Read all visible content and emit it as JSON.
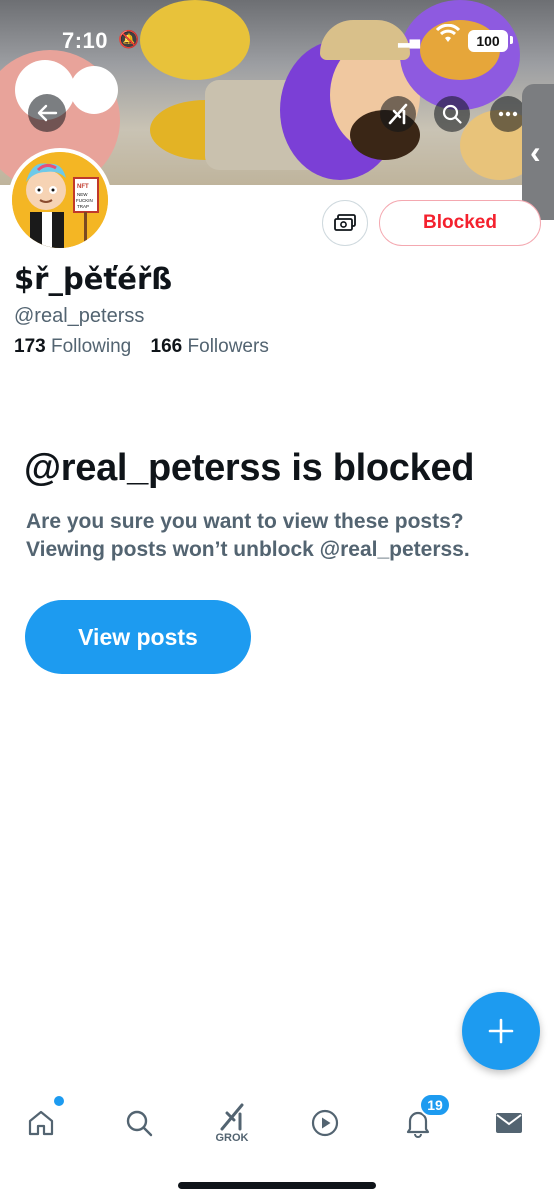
{
  "status_bar": {
    "time": "7:10",
    "battery": "100"
  },
  "header": {
    "back_icon": "arrow-left-icon",
    "grok_icon": "grok-icon",
    "search_icon": "search-icon",
    "more_icon": "more-horizontal-icon"
  },
  "profile": {
    "display_name": "$ř_þěťéřß",
    "handle": "@real_peterss",
    "following_count": "173",
    "following_label": "Following",
    "followers_count": "166",
    "followers_label": "Followers",
    "blocked_button_label": "Blocked",
    "avatar_sign_text": "NFT NEW FUCKIN TRAP"
  },
  "blocked_notice": {
    "title": "@real_peterss is blocked",
    "description": "Are you sure you want to view these posts? Viewing posts won’t unblock @real_peterss.",
    "view_button_label": "View posts"
  },
  "fab": {
    "label": "+"
  },
  "bottom_nav": {
    "grok_label": "GROK",
    "notifications_badge": "19",
    "items": [
      "home-icon",
      "search-icon",
      "grok-icon",
      "video-icon",
      "bell-icon",
      "mail-icon"
    ]
  },
  "colors": {
    "accent": "#1d9bf0",
    "blocked_red": "#f4212e",
    "secondary_text": "#536471",
    "primary_text": "#0f1419"
  }
}
